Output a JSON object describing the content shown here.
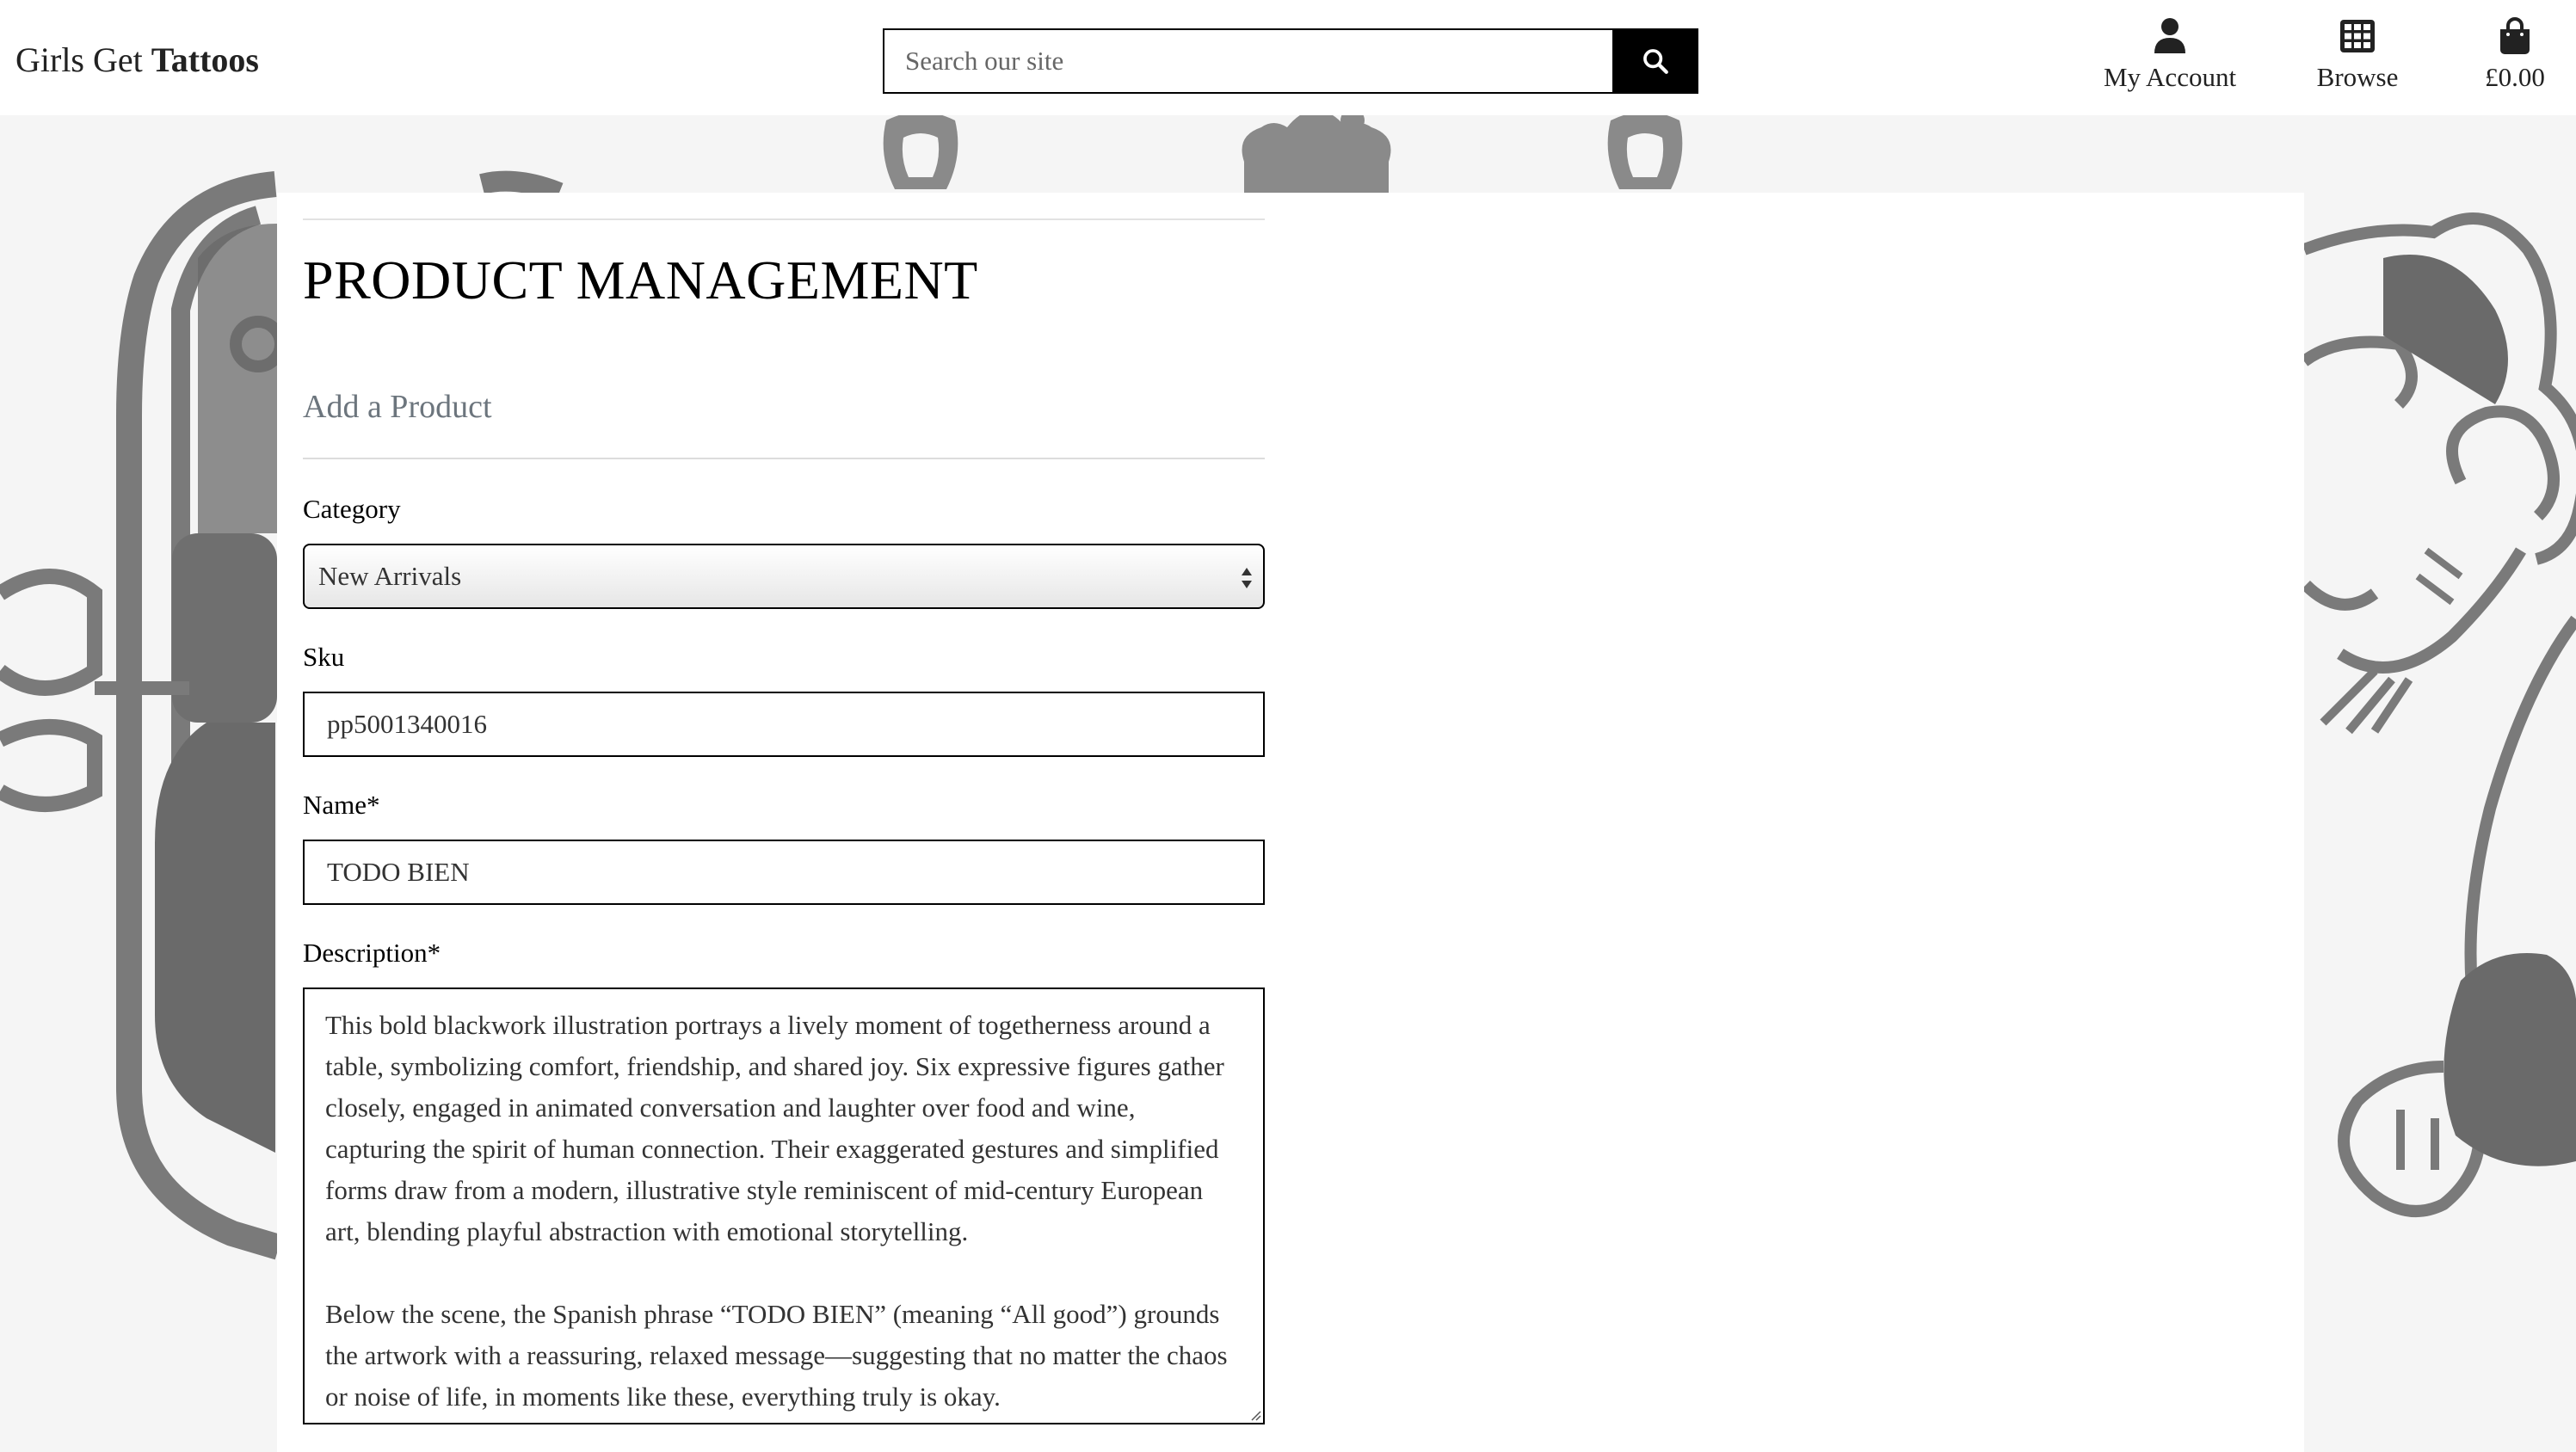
{
  "header": {
    "brand_regular": "Girls Get",
    "brand_bold": "Tattoos",
    "search_placeholder": "Search our site",
    "nav": {
      "account_label": "My Account",
      "browse_label": "Browse",
      "bag_total": "£0.00"
    }
  },
  "page": {
    "title": "PRODUCT MANAGEMENT",
    "subtitle": "Add a Product"
  },
  "form": {
    "category": {
      "label": "Category",
      "selected": "New Arrivals"
    },
    "sku": {
      "label": "Sku",
      "value": "pp5001340016"
    },
    "name": {
      "label": "Name*",
      "value": "TODO BIEN"
    },
    "description": {
      "label": "Description*",
      "paragraph_1": "This bold blackwork illustration portrays a lively moment of togetherness around a table, symbolizing comfort, friendship, and shared joy. Six expressive figures gather closely, engaged in animated conversation and laughter over food and wine, capturing the spirit of human connection. Their exaggerated gestures and simplified forms draw from a modern, illustrative style reminiscent of mid-century European art, blending playful abstraction with emotional storytelling.",
      "paragraph_2": "Below the scene, the Spanish phrase “TODO BIEN” (meaning “All good”) grounds the artwork with a reassuring, relaxed message—suggesting that no matter the chaos or noise of life, in moments like these, everything truly is okay."
    }
  },
  "icons": {
    "search": "search-icon",
    "account": "user-icon",
    "browse": "grid-icon",
    "bag": "shopping-bag-icon"
  },
  "colors": {
    "background": "#f5f5f5",
    "panel": "#ffffff",
    "text": "#000000",
    "muted_heading": "#6c757d",
    "search_button": "#000000",
    "decor_art": "#888888"
  }
}
